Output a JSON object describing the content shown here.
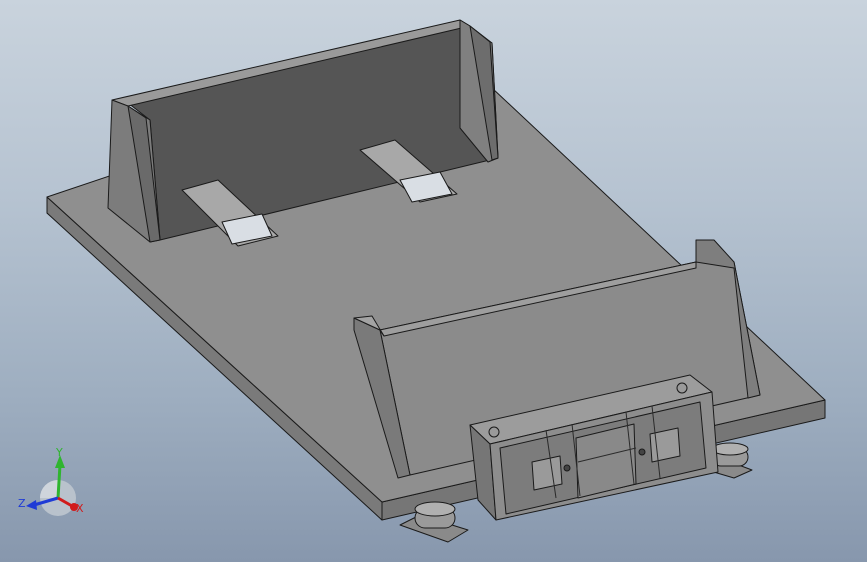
{
  "viewport": {
    "background_top": "#c9d3dd",
    "background_bottom": "#8797ad"
  },
  "model": {
    "part_color_top": "#8c8c8c",
    "part_color_side": "#6e6e6e",
    "part_color_dark": "#4e4e4e",
    "edge_color": "#1a1a1a"
  },
  "triad": {
    "y_label": "Y",
    "z_label": "Z",
    "x_label": "X",
    "y_color": "#2fb52f",
    "z_color": "#1f3bd6",
    "x_color": "#d11b1b"
  }
}
